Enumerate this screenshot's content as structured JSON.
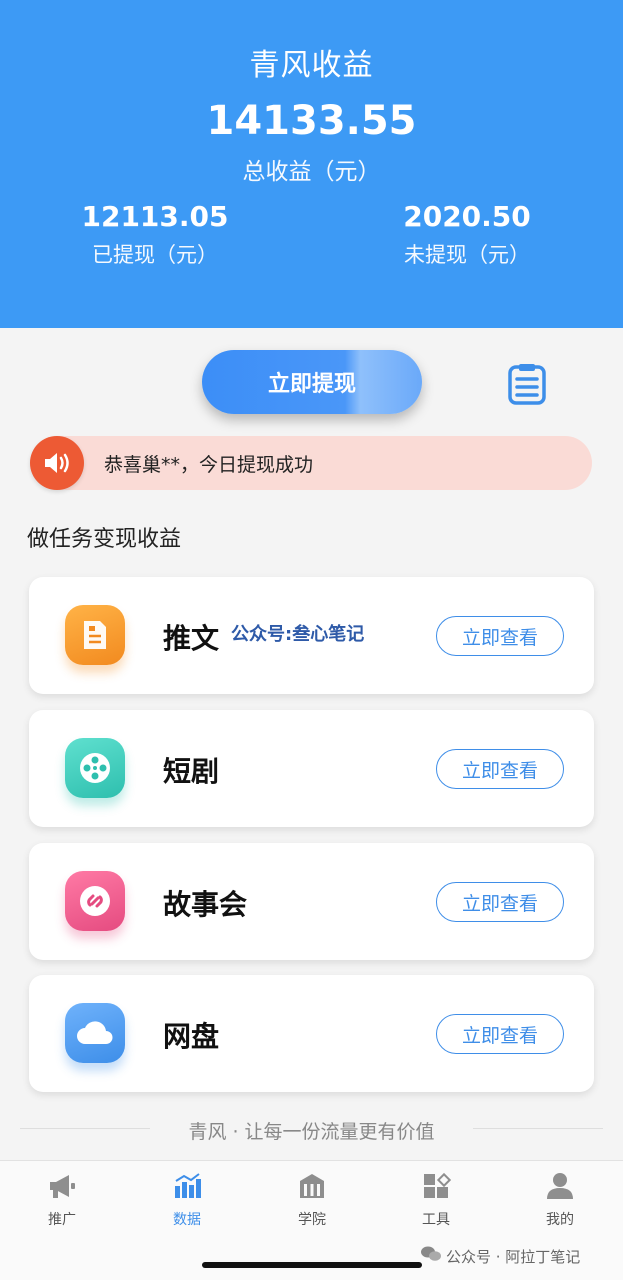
{
  "header": {
    "title": "青风收益",
    "total_value": "14133.55",
    "total_label": "总收益（元）",
    "withdrawn_value": "12113.05",
    "withdrawn_label": "已提现（元）",
    "pending_value": "2020.50",
    "pending_label": "未提现（元）"
  },
  "actions": {
    "withdraw_label": "立即提现",
    "record_icon": "clipboard-list-icon"
  },
  "notice": {
    "icon": "speaker-icon",
    "text": "恭喜巢**，今日提现成功"
  },
  "section": {
    "title": "做任务变现收益"
  },
  "tasks": [
    {
      "title": "推文",
      "button": "立即查看",
      "icon": "document-icon",
      "color": "#f59a2c"
    },
    {
      "title": "短剧",
      "button": "立即查看",
      "icon": "film-reel-icon",
      "color": "#3ccfc0"
    },
    {
      "title": "故事会",
      "button": "立即查看",
      "icon": "link-icon",
      "color": "#ec5a8c"
    },
    {
      "title": "网盘",
      "button": "立即查看",
      "icon": "cloud-icon",
      "color": "#3d8ee9"
    }
  ],
  "watermark": "公众号:叁心笔记",
  "slogan": "青风 · 让每一份流量更有价值",
  "tabbar": [
    {
      "label": "推广",
      "icon": "megaphone-icon"
    },
    {
      "label": "数据",
      "icon": "bar-chart-icon",
      "active": true
    },
    {
      "label": "学院",
      "icon": "building-icon"
    },
    {
      "label": "工具",
      "icon": "grid-tools-icon"
    },
    {
      "label": "我的",
      "icon": "user-icon"
    }
  ],
  "footer_mark": "公众号 · 阿拉丁笔记",
  "colors": {
    "primary": "#3d9af5",
    "accent_button": "#3f8ee8",
    "notice_bg": "#fadbd6",
    "notice_icon": "#ed5a34"
  }
}
